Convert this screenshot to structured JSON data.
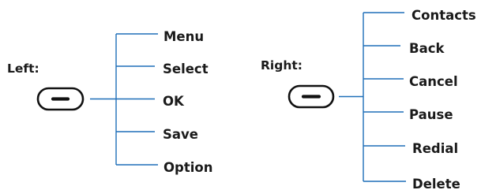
{
  "left": {
    "label": "Left:",
    "key_icon": "softkey-minus-icon",
    "items": [
      "Menu",
      "Select",
      "OK",
      "Save",
      "Option"
    ]
  },
  "right": {
    "label": "Right:",
    "key_icon": "softkey-minus-icon",
    "items": [
      "Contacts",
      "Back",
      "Cancel",
      "Pause",
      "Redial",
      "Delete"
    ]
  },
  "colors": {
    "tree_lines": "#1f6fb8",
    "text": "#1a1a1a",
    "key_outline": "#111111"
  }
}
